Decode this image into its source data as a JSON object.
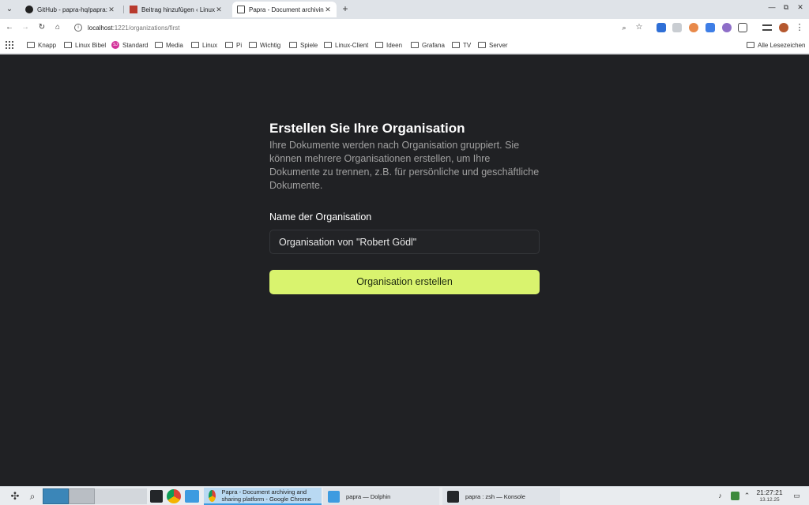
{
  "browser": {
    "tabs": [
      {
        "title": "GitHub - papra-hq/papra: Th",
        "close": "✕"
      },
      {
        "title": "Beitrag hinzufügen ‹ Linux",
        "close": "✕"
      },
      {
        "title": "Papra - Document archiving",
        "close": "✕"
      }
    ],
    "new_tab": "+",
    "window_controls": [
      "—",
      "⧉",
      "✕"
    ],
    "nav": {
      "back": "←",
      "forward": "→",
      "reload": "↻",
      "home": "⌂"
    },
    "address": {
      "host": "localhost",
      "path": ":1221/organizations/first"
    },
    "toolbar_icons": [
      "⌕",
      "☆"
    ],
    "bookmarks": [
      "Knapp",
      "Linux Bibel",
      "Standard",
      "Media",
      "Linux",
      "Pi",
      "Wichtig",
      "Spiele",
      "Linux-Client",
      "Ideen",
      "Grafana",
      "TV",
      "Server"
    ],
    "all_bookmarks": "Alle Lesezeichen",
    "standard_badge": "SJ"
  },
  "page": {
    "title": "Erstellen Sie Ihre Organisation",
    "description": "Ihre Dokumente werden nach Organisation gruppiert. Sie können mehrere Organisationen erstellen, um Ihre Dokumente zu trennen, z.B. für persönliche und geschäftliche Dokumente.",
    "name_label": "Name der Organisation",
    "name_value": "Organisation von \"Robert Gödl\"",
    "submit": "Organisation erstellen"
  },
  "taskbar": {
    "tasks": [
      {
        "title": "Papra - Document archiving and sharing platform - Google Chrome"
      },
      {
        "title": "papra — Dolphin"
      },
      {
        "title": "papra : zsh — Konsole"
      }
    ],
    "time": "21:27:21",
    "date": "13.12.25"
  },
  "colors": {
    "accent": "#d9f36e",
    "background": "#202124"
  }
}
